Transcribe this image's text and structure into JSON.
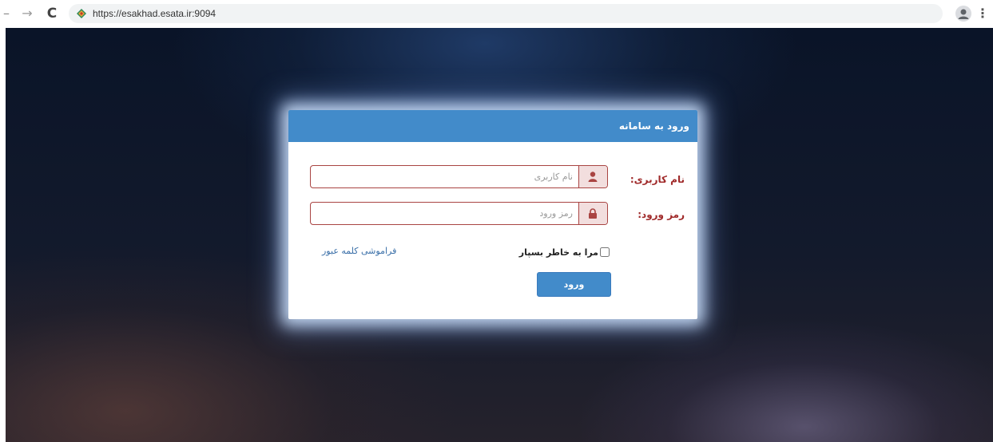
{
  "browser": {
    "url": "https://esakhad.esata.ir:9094",
    "back_icon": "back-arrow-icon",
    "forward_icon": "forward-arrow-icon",
    "reload_icon": "reload-icon",
    "menu_icon": "menu-dots-icon"
  },
  "login": {
    "title": "ورود به سامانه",
    "username_label": "نام کاربری:",
    "username_placeholder": "نام کاربری",
    "password_label": "رمز ورود:",
    "password_placeholder": "رمز ورود",
    "remember_label": "مرا به خاطر بسپار",
    "forgot_link": "فراموشی کلمه عبور",
    "submit_label": "ورود"
  },
  "colors": {
    "header_blue": "#428bca",
    "error_red": "#a94442",
    "addon_bg": "#f2dede"
  }
}
